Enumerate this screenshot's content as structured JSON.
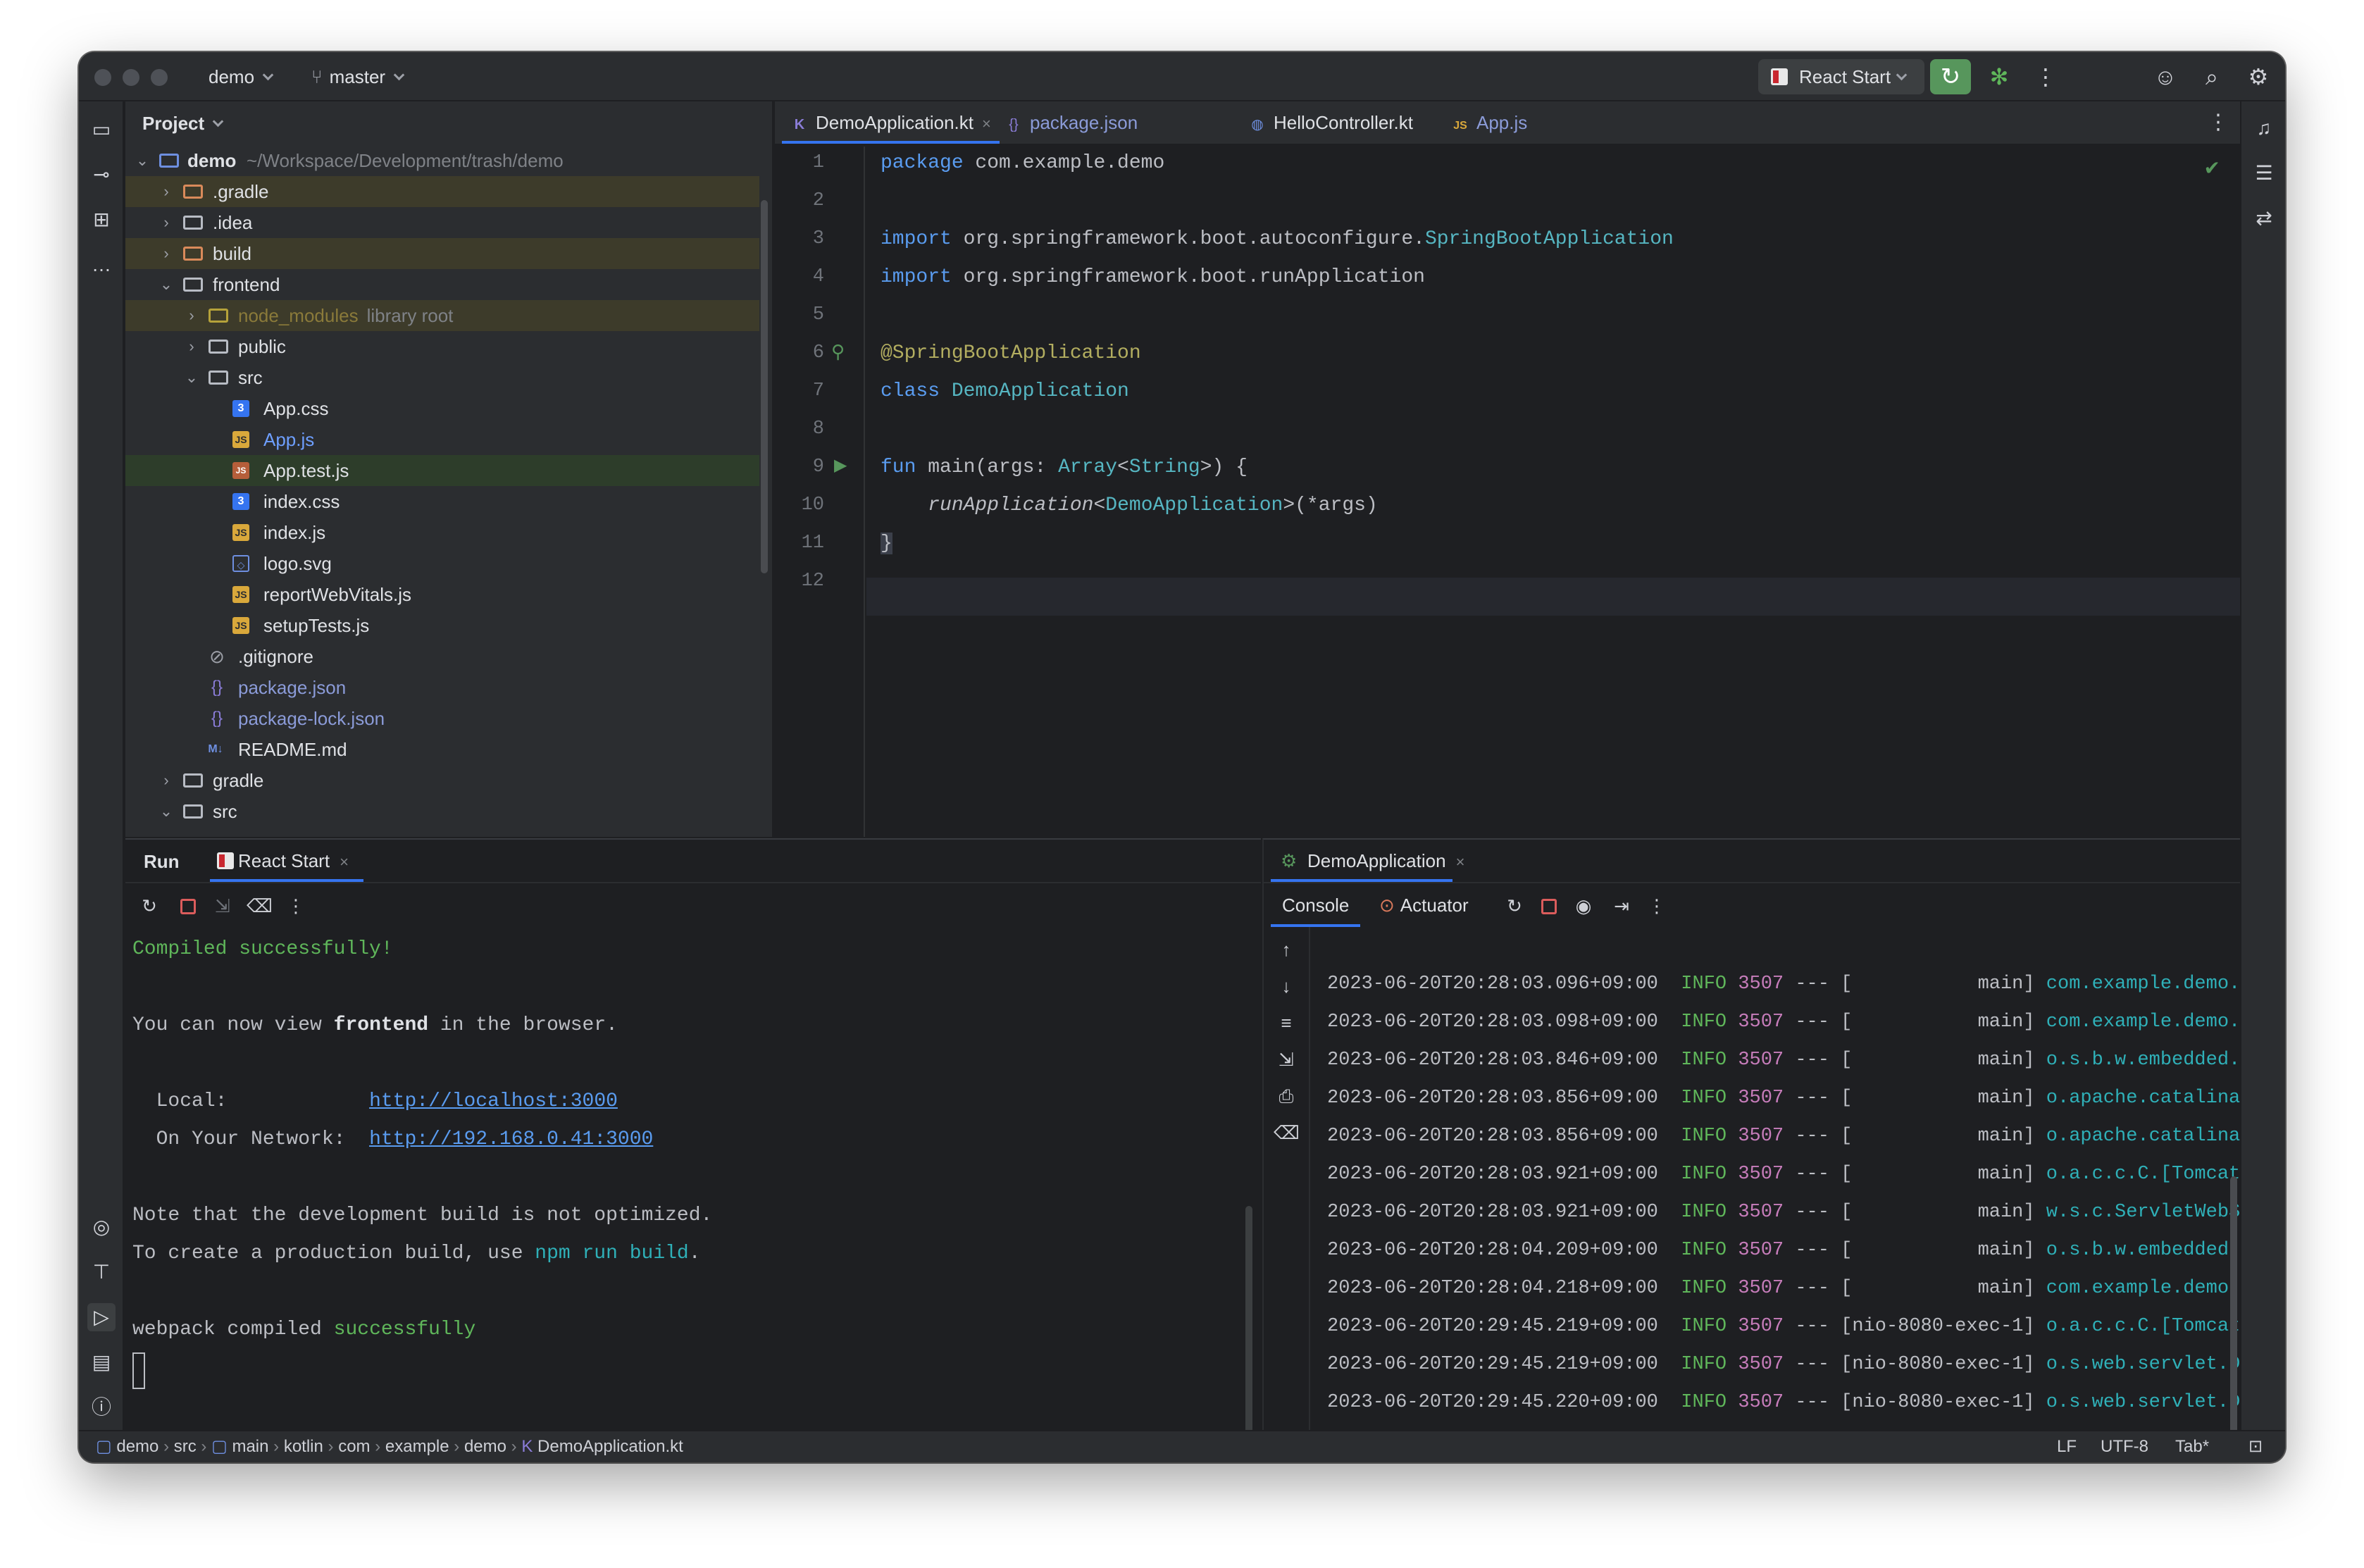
{
  "titlebar": {
    "project": "demo",
    "branch": "master",
    "run_config": "React Start"
  },
  "project_panel": {
    "title": "Project",
    "root": {
      "name": "demo",
      "path": "~/Workspace/Development/trash/demo"
    },
    "items": [
      {
        "name": ".gradle"
      },
      {
        "name": ".idea"
      },
      {
        "name": "build"
      },
      {
        "name": "frontend"
      },
      {
        "name": "node_modules",
        "hint": "library root"
      },
      {
        "name": "public"
      },
      {
        "name": "src"
      },
      {
        "name": "App.css"
      },
      {
        "name": "App.js"
      },
      {
        "name": "App.test.js"
      },
      {
        "name": "index.css"
      },
      {
        "name": "index.js"
      },
      {
        "name": "logo.svg"
      },
      {
        "name": "reportWebVitals.js"
      },
      {
        "name": "setupTests.js"
      },
      {
        "name": ".gitignore"
      },
      {
        "name": "package.json"
      },
      {
        "name": "package-lock.json"
      },
      {
        "name": "README.md"
      },
      {
        "name": "gradle"
      },
      {
        "name": "src"
      }
    ]
  },
  "editor": {
    "tabs": [
      {
        "label": "DemoApplication.kt"
      },
      {
        "label": "package.json"
      },
      {
        "label": "HelloController.kt"
      },
      {
        "label": "App.js"
      }
    ],
    "line_numbers": [
      "1",
      "2",
      "3",
      "4",
      "5",
      "6",
      "7",
      "8",
      "9",
      "10",
      "11",
      "12"
    ],
    "code": {
      "l1_kw": "package",
      "l1_rest": " com.example.demo",
      "l3_kw": "import",
      "l3_pkg": " org.springframework.boot.autoconfigure.",
      "l3_cls": "SpringBootApplication",
      "l4_kw": "import",
      "l4_pkg": " org.springframework.boot.runApplication",
      "l6_ann": "@SpringBootApplication",
      "l7_kw": "class",
      "l7_cls": " DemoApplication",
      "l9_kw": "fun",
      "l9_fn": " main",
      "l9_p1": "(",
      "l9_arg": "args",
      "l9_colon": ": ",
      "l9_type": "Array",
      "l9_lt": "<",
      "l9_type2": "String",
      "l9_rest": ">) {",
      "l10_indent": "    ",
      "l10_fn": "runApplication",
      "l10_lt": "<",
      "l10_cls": "DemoApplication",
      "l10_gt": ">(*",
      "l10_arg": "args",
      "l10_end": ")",
      "l11": "}"
    }
  },
  "run_panel": {
    "title": "Run",
    "tab": "React Start",
    "output": {
      "compiled": "Compiled successfully!",
      "view_pre": "You can now view ",
      "view_bold": "frontend",
      "view_post": " in the browser.",
      "local_label": "  Local:            ",
      "local_url": "http://localhost:3000",
      "network_label": "  On Your Network:  ",
      "network_url": "http://192.168.0.41:3000",
      "note": "Note that the development build is not optimized.",
      "prod_pre": "To create a production build, use ",
      "prod_cmd": "npm run build",
      "prod_post": ".",
      "webpack_pre": "webpack compiled ",
      "webpack_status": "successfully"
    }
  },
  "console_panel": {
    "title": "DemoApplication",
    "tabs": {
      "console": "Console",
      "actuator": "Actuator"
    },
    "logs": [
      {
        "ts": "2023-06-20T20:28:03.096+09:00",
        "level": "INFO",
        "pid": "3507",
        "sep": " --- [",
        "thread": "           main] ",
        "logger": "com.example.demo.DemoAp"
      },
      {
        "ts": "2023-06-20T20:28:03.098+09:00",
        "level": "INFO",
        "pid": "3507",
        "sep": " --- [",
        "thread": "           main] ",
        "logger": "com.example.demo.DemoAp"
      },
      {
        "ts": "2023-06-20T20:28:03.846+09:00",
        "level": "INFO",
        "pid": "3507",
        "sep": " --- [",
        "thread": "           main] ",
        "logger": "o.s.b.w.embedded.tomcat"
      },
      {
        "ts": "2023-06-20T20:28:03.856+09:00",
        "level": "INFO",
        "pid": "3507",
        "sep": " --- [",
        "thread": "           main] ",
        "logger": "o.apache.catalina.core.S"
      },
      {
        "ts": "2023-06-20T20:28:03.856+09:00",
        "level": "INFO",
        "pid": "3507",
        "sep": " --- [",
        "thread": "           main] ",
        "logger": "o.apache.catalina.core.S"
      },
      {
        "ts": "2023-06-20T20:28:03.921+09:00",
        "level": "INFO",
        "pid": "3507",
        "sep": " --- [",
        "thread": "           main] ",
        "logger": "o.a.c.c.C.[Tomcat].[loca"
      },
      {
        "ts": "2023-06-20T20:28:03.921+09:00",
        "level": "INFO",
        "pid": "3507",
        "sep": " --- [",
        "thread": "           main] ",
        "logger": "w.s.c.ServletWebServerAp"
      },
      {
        "ts": "2023-06-20T20:28:04.209+09:00",
        "level": "INFO",
        "pid": "3507",
        "sep": " --- [",
        "thread": "           main] ",
        "logger": "o.s.b.w.embedded.tomcat"
      },
      {
        "ts": "2023-06-20T20:28:04.218+09:00",
        "level": "INFO",
        "pid": "3507",
        "sep": " --- [",
        "thread": "           main] ",
        "logger": "com.example.demo.DemoAp"
      },
      {
        "ts": "2023-06-20T20:29:45.219+09:00",
        "level": "INFO",
        "pid": "3507",
        "sep": " --- [",
        "thread": "nio-8080-exec-1] ",
        "logger": "o.a.c.c.C.[Tomcat].[loca"
      },
      {
        "ts": "2023-06-20T20:29:45.219+09:00",
        "level": "INFO",
        "pid": "3507",
        "sep": " --- [",
        "thread": "nio-8080-exec-1] ",
        "logger": "o.s.web.servlet.Dispatc"
      },
      {
        "ts": "2023-06-20T20:29:45.220+09:00",
        "level": "INFO",
        "pid": "3507",
        "sep": " --- [",
        "thread": "nio-8080-exec-1] ",
        "logger": "o.s.web.servlet.Dispatc"
      }
    ]
  },
  "statusbar": {
    "breadcrumbs": [
      "demo",
      "src",
      "main",
      "kotlin",
      "com",
      "example",
      "demo",
      "DemoApplication.kt"
    ],
    "line_sep": "LF",
    "encoding": "UTF-8",
    "indent": "Tab*"
  }
}
